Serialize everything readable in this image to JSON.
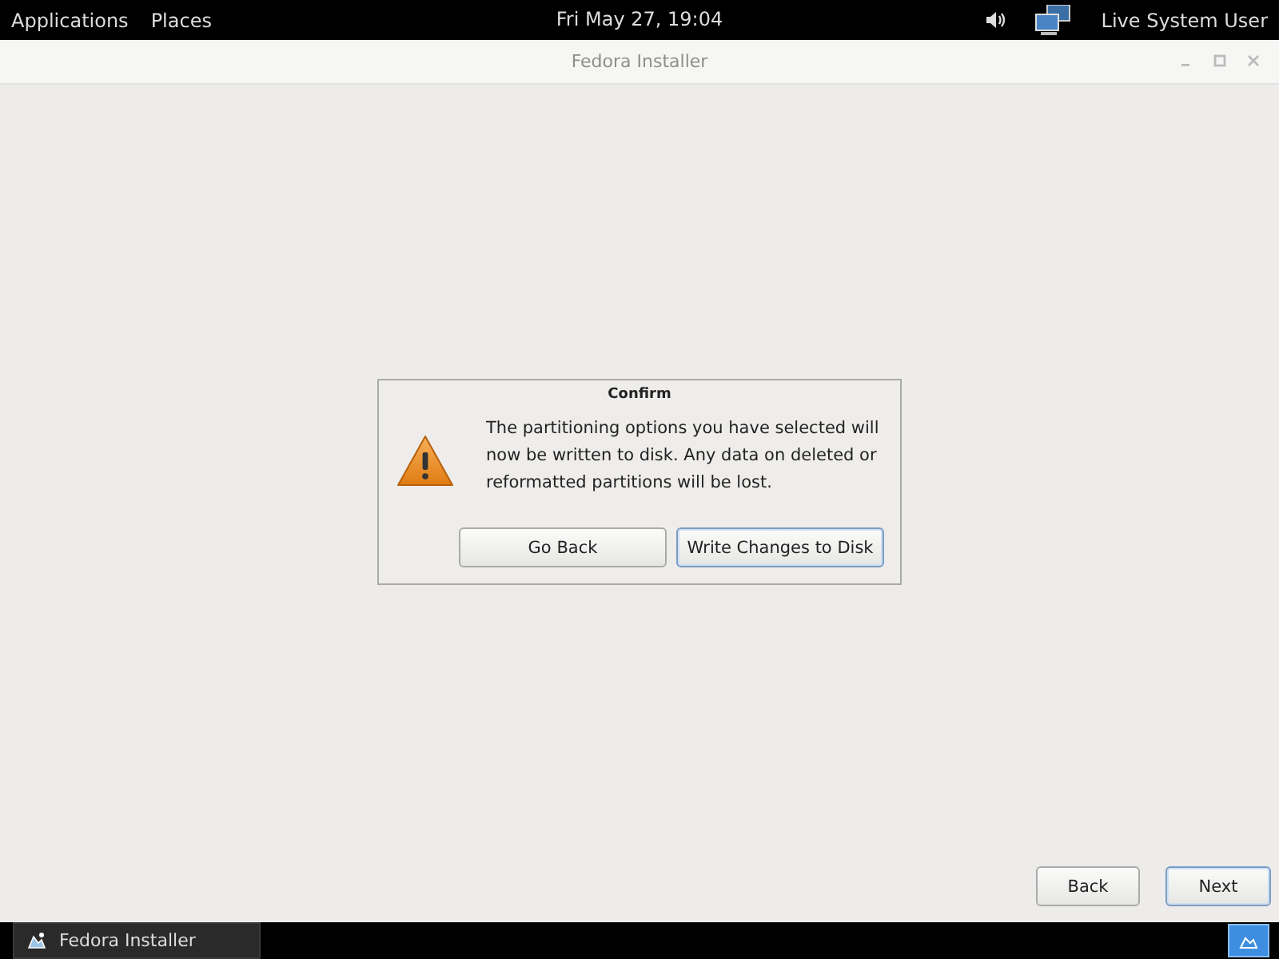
{
  "top_bar": {
    "menus": [
      "Applications",
      "Places"
    ],
    "clock": "Fri May 27, 19:04",
    "user": "Live System User"
  },
  "window": {
    "title": "Fedora Installer"
  },
  "dialog": {
    "title": "Confirm",
    "message": "The partitioning options you have selected will now be written to disk.  Any data on deleted or reformatted partitions will be lost.",
    "buttons": [
      {
        "label": "Go Back",
        "focused": false
      },
      {
        "label": "Write Changes to Disk",
        "focused": true
      }
    ]
  },
  "nav_buttons": [
    {
      "label": "Back",
      "focused": false
    },
    {
      "label": "Next",
      "focused": true
    }
  ],
  "taskbar": {
    "items": [
      {
        "label": "Fedora Installer",
        "selected": false
      }
    ],
    "workspaces": [
      {
        "selected": true
      }
    ]
  }
}
